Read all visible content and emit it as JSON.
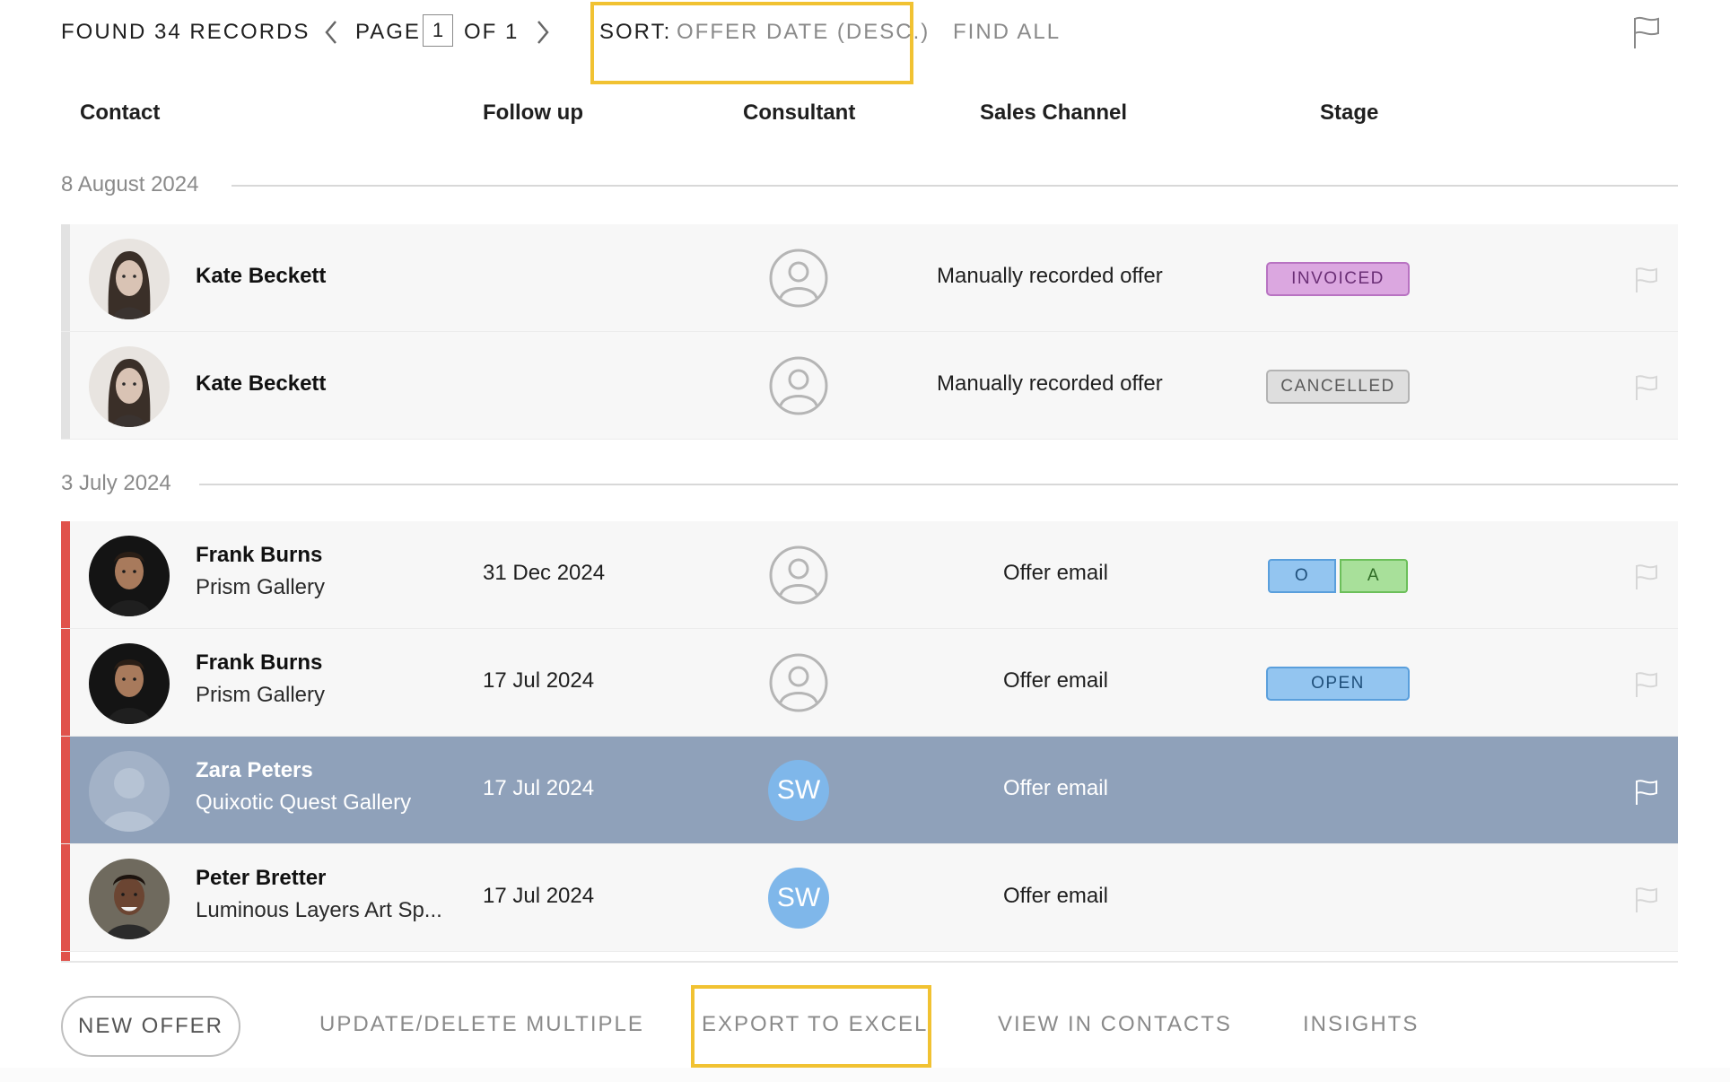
{
  "toolbar": {
    "found_label": "FOUND 34 RECORDS",
    "page_label": "PAGE",
    "page_value": "1",
    "of_label": "OF 1",
    "sort_key": "SORT:",
    "sort_value": "OFFER DATE (DESC.)",
    "find_all": "FIND ALL"
  },
  "columns": {
    "contact": "Contact",
    "follow_up": "Follow up",
    "consultant": "Consultant",
    "sales_channel": "Sales Channel",
    "stage": "Stage"
  },
  "groups": [
    {
      "date": "8 August 2024",
      "rows": [
        {
          "name": "Kate Beckett",
          "company": "",
          "follow_up": "",
          "consultant": "",
          "channel": "Manually recorded offer",
          "stage": "INVOICED"
        },
        {
          "name": "Kate Beckett",
          "company": "",
          "follow_up": "",
          "consultant": "",
          "channel": "Manually recorded offer",
          "stage": "CANCELLED"
        }
      ]
    },
    {
      "date": "3 July 2024",
      "rows": [
        {
          "name": "Frank Burns",
          "company": "Prism Gallery",
          "follow_up": "31 Dec 2024",
          "consultant": "",
          "channel": "Offer email",
          "stage_parts": [
            "O",
            "A"
          ]
        },
        {
          "name": "Frank Burns",
          "company": "Prism Gallery",
          "follow_up": "17 Jul 2024",
          "consultant": "",
          "channel": "Offer email",
          "stage": "OPEN"
        },
        {
          "name": "Zara Peters",
          "company": "Quixotic Quest Gallery",
          "follow_up": "17 Jul 2024",
          "consultant": "SW",
          "channel": "Offer email",
          "stage": ""
        },
        {
          "name": "Peter Bretter",
          "company": "Luminous Layers Art Sp...",
          "follow_up": "17 Jul 2024",
          "consultant": "SW",
          "channel": "Offer email",
          "stage": ""
        }
      ]
    }
  ],
  "actions": {
    "new_offer": "NEW OFFER",
    "update_delete": "UPDATE/DELETE MULTIPLE",
    "export": "EXPORT TO EXCEL",
    "view_contacts": "VIEW IN CONTACTS",
    "insights": "INSIGHTS"
  },
  "colors": {
    "priority_bar": "#e0524b",
    "highlight_outline": "#f1c232",
    "selected_row": "#8fa1ba",
    "consultant_initials_bg": "#7fb7ea"
  },
  "icons": [
    "chevron-left-icon",
    "chevron-right-icon",
    "flag-icon",
    "user-circle-icon"
  ]
}
